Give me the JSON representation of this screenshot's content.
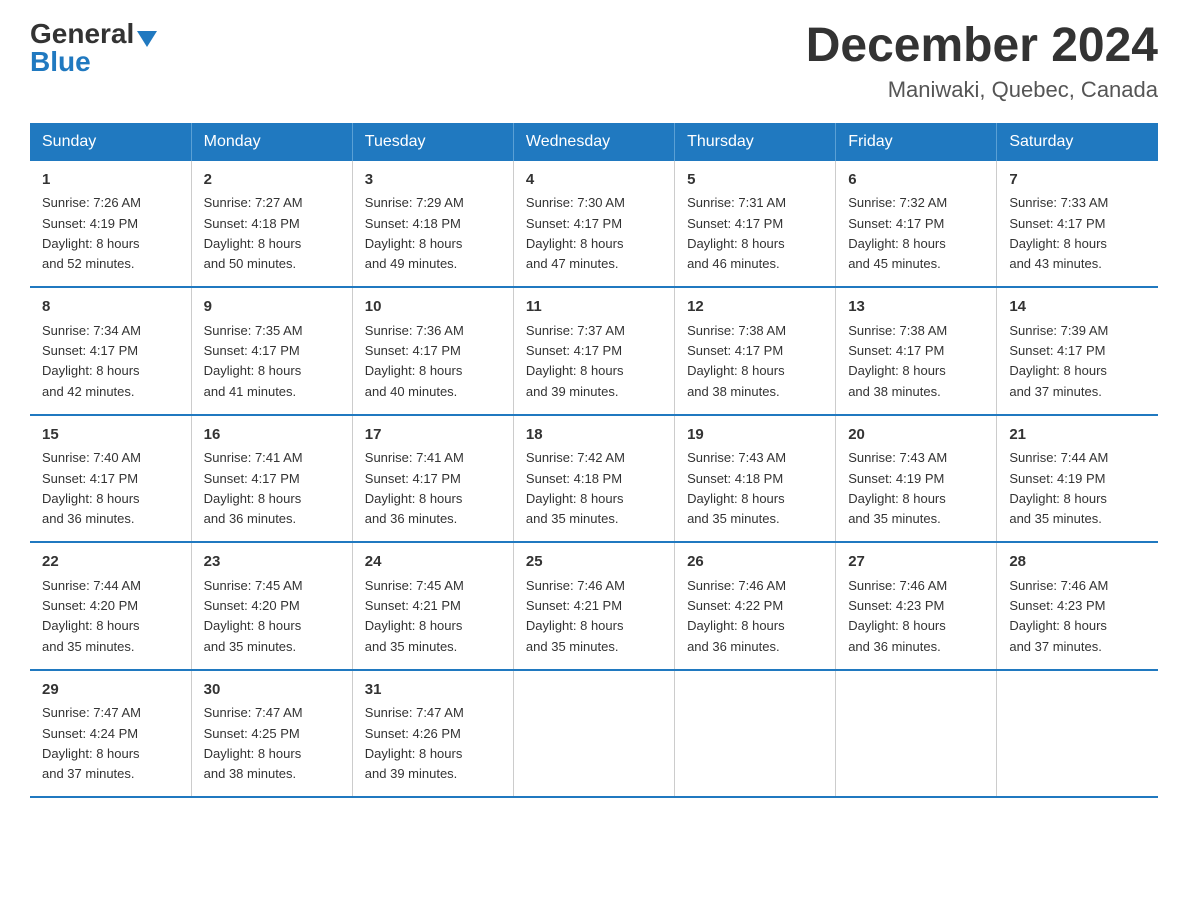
{
  "header": {
    "logo_general": "General",
    "logo_blue": "Blue",
    "month_year": "December 2024",
    "location": "Maniwaki, Quebec, Canada"
  },
  "days_of_week": [
    "Sunday",
    "Monday",
    "Tuesday",
    "Wednesday",
    "Thursday",
    "Friday",
    "Saturday"
  ],
  "weeks": [
    [
      {
        "day": "1",
        "sunrise": "7:26 AM",
        "sunset": "4:19 PM",
        "daylight": "8 hours and 52 minutes."
      },
      {
        "day": "2",
        "sunrise": "7:27 AM",
        "sunset": "4:18 PM",
        "daylight": "8 hours and 50 minutes."
      },
      {
        "day": "3",
        "sunrise": "7:29 AM",
        "sunset": "4:18 PM",
        "daylight": "8 hours and 49 minutes."
      },
      {
        "day": "4",
        "sunrise": "7:30 AM",
        "sunset": "4:17 PM",
        "daylight": "8 hours and 47 minutes."
      },
      {
        "day": "5",
        "sunrise": "7:31 AM",
        "sunset": "4:17 PM",
        "daylight": "8 hours and 46 minutes."
      },
      {
        "day": "6",
        "sunrise": "7:32 AM",
        "sunset": "4:17 PM",
        "daylight": "8 hours and 45 minutes."
      },
      {
        "day": "7",
        "sunrise": "7:33 AM",
        "sunset": "4:17 PM",
        "daylight": "8 hours and 43 minutes."
      }
    ],
    [
      {
        "day": "8",
        "sunrise": "7:34 AM",
        "sunset": "4:17 PM",
        "daylight": "8 hours and 42 minutes."
      },
      {
        "day": "9",
        "sunrise": "7:35 AM",
        "sunset": "4:17 PM",
        "daylight": "8 hours and 41 minutes."
      },
      {
        "day": "10",
        "sunrise": "7:36 AM",
        "sunset": "4:17 PM",
        "daylight": "8 hours and 40 minutes."
      },
      {
        "day": "11",
        "sunrise": "7:37 AM",
        "sunset": "4:17 PM",
        "daylight": "8 hours and 39 minutes."
      },
      {
        "day": "12",
        "sunrise": "7:38 AM",
        "sunset": "4:17 PM",
        "daylight": "8 hours and 38 minutes."
      },
      {
        "day": "13",
        "sunrise": "7:38 AM",
        "sunset": "4:17 PM",
        "daylight": "8 hours and 38 minutes."
      },
      {
        "day": "14",
        "sunrise": "7:39 AM",
        "sunset": "4:17 PM",
        "daylight": "8 hours and 37 minutes."
      }
    ],
    [
      {
        "day": "15",
        "sunrise": "7:40 AM",
        "sunset": "4:17 PM",
        "daylight": "8 hours and 36 minutes."
      },
      {
        "day": "16",
        "sunrise": "7:41 AM",
        "sunset": "4:17 PM",
        "daylight": "8 hours and 36 minutes."
      },
      {
        "day": "17",
        "sunrise": "7:41 AM",
        "sunset": "4:17 PM",
        "daylight": "8 hours and 36 minutes."
      },
      {
        "day": "18",
        "sunrise": "7:42 AM",
        "sunset": "4:18 PM",
        "daylight": "8 hours and 35 minutes."
      },
      {
        "day": "19",
        "sunrise": "7:43 AM",
        "sunset": "4:18 PM",
        "daylight": "8 hours and 35 minutes."
      },
      {
        "day": "20",
        "sunrise": "7:43 AM",
        "sunset": "4:19 PM",
        "daylight": "8 hours and 35 minutes."
      },
      {
        "day": "21",
        "sunrise": "7:44 AM",
        "sunset": "4:19 PM",
        "daylight": "8 hours and 35 minutes."
      }
    ],
    [
      {
        "day": "22",
        "sunrise": "7:44 AM",
        "sunset": "4:20 PM",
        "daylight": "8 hours and 35 minutes."
      },
      {
        "day": "23",
        "sunrise": "7:45 AM",
        "sunset": "4:20 PM",
        "daylight": "8 hours and 35 minutes."
      },
      {
        "day": "24",
        "sunrise": "7:45 AM",
        "sunset": "4:21 PM",
        "daylight": "8 hours and 35 minutes."
      },
      {
        "day": "25",
        "sunrise": "7:46 AM",
        "sunset": "4:21 PM",
        "daylight": "8 hours and 35 minutes."
      },
      {
        "day": "26",
        "sunrise": "7:46 AM",
        "sunset": "4:22 PM",
        "daylight": "8 hours and 36 minutes."
      },
      {
        "day": "27",
        "sunrise": "7:46 AM",
        "sunset": "4:23 PM",
        "daylight": "8 hours and 36 minutes."
      },
      {
        "day": "28",
        "sunrise": "7:46 AM",
        "sunset": "4:23 PM",
        "daylight": "8 hours and 37 minutes."
      }
    ],
    [
      {
        "day": "29",
        "sunrise": "7:47 AM",
        "sunset": "4:24 PM",
        "daylight": "8 hours and 37 minutes."
      },
      {
        "day": "30",
        "sunrise": "7:47 AM",
        "sunset": "4:25 PM",
        "daylight": "8 hours and 38 minutes."
      },
      {
        "day": "31",
        "sunrise": "7:47 AM",
        "sunset": "4:26 PM",
        "daylight": "8 hours and 39 minutes."
      },
      null,
      null,
      null,
      null
    ]
  ],
  "labels": {
    "sunrise": "Sunrise: ",
    "sunset": "Sunset: ",
    "daylight": "Daylight: "
  }
}
